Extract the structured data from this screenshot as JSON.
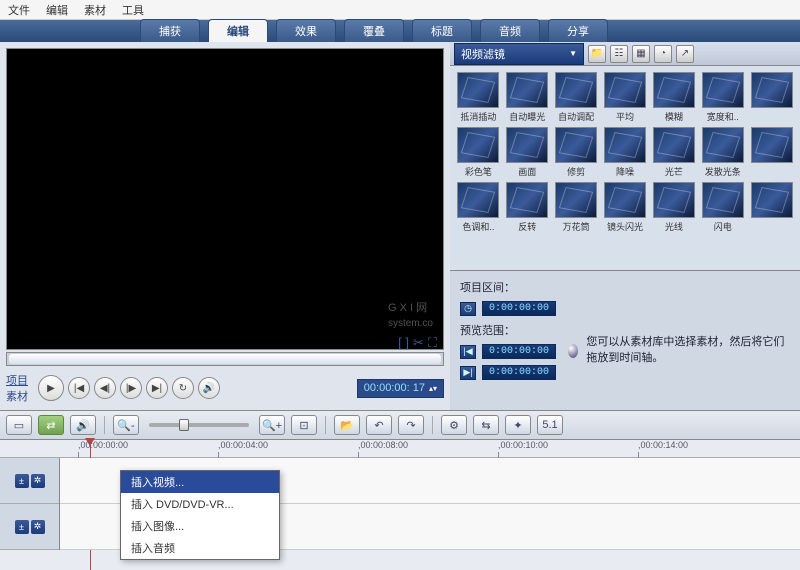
{
  "menubar": {
    "items": [
      "文件",
      "编辑",
      "素材",
      "工具"
    ]
  },
  "tabs": [
    {
      "label": "捕获"
    },
    {
      "label": "编辑",
      "active": true
    },
    {
      "label": "效果"
    },
    {
      "label": "覆叠"
    },
    {
      "label": "标题"
    },
    {
      "label": "音频"
    },
    {
      "label": "分享"
    }
  ],
  "watermark": {
    "main": "G X I 网",
    "sub": "system.co"
  },
  "preview": {
    "mode_labels": [
      "项目",
      "素材"
    ],
    "timecode": "00:00:00: 17"
  },
  "library": {
    "dropdown": "视频滤镜",
    "items": [
      "抵消插动",
      "自动曝光",
      "自动调配",
      "平均",
      "模糊",
      "宽度和..",
      "",
      "彩色笔",
      "画面",
      "修剪",
      "降噪",
      "光芒",
      "发散光条",
      "",
      "色调和..",
      "反转",
      "万花筒",
      "镜头闪光",
      "光线",
      "闪电",
      ""
    ]
  },
  "info": {
    "range_label": "项目区间：",
    "preview_label": "预览范围：",
    "tc1": "0:00:00:00",
    "tc2": "0:00:00:00",
    "tc3": "0:00:00:00",
    "hint": "您可以从素材库中选择素材，然后将它们拖放到时间轴。"
  },
  "ruler": {
    "marks": [
      {
        "pos": 78,
        "label": ",00:00:00:00"
      },
      {
        "pos": 218,
        "label": ",00:00:04:00"
      },
      {
        "pos": 358,
        "label": ",00:00:08:00"
      },
      {
        "pos": 498,
        "label": ",00:00:10:00"
      },
      {
        "pos": 638,
        "label": ",00:00:14:00"
      }
    ]
  },
  "context_menu": {
    "items": [
      {
        "label": "插入视频...",
        "hl": true
      },
      {
        "label": "插入 DVD/DVD-VR..."
      },
      {
        "label": "插入图像..."
      },
      {
        "label": "插入音频"
      }
    ]
  }
}
